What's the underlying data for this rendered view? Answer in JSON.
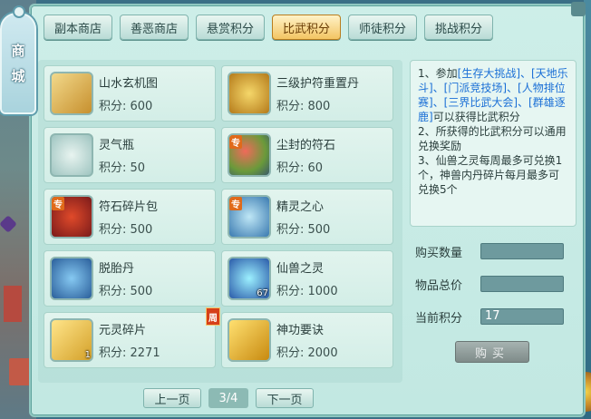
{
  "side_tab": {
    "char1": "商",
    "char2": "城"
  },
  "tabs": [
    {
      "label": "副本商店",
      "active": false
    },
    {
      "label": "善恶商店",
      "active": false
    },
    {
      "label": "悬赏积分",
      "active": false
    },
    {
      "label": "比武积分",
      "active": true
    },
    {
      "label": "师徒积分",
      "active": false
    },
    {
      "label": "挑战积分",
      "active": false
    }
  ],
  "items": [
    {
      "name": "山水玄机图",
      "points": "积分: 600",
      "icon": "scroll-icon",
      "badge": "",
      "qty": "",
      "weekly": ""
    },
    {
      "name": "三级护符重置丹",
      "points": "积分: 800",
      "icon": "amulet-icon",
      "badge": "",
      "qty": "",
      "weekly": ""
    },
    {
      "name": "灵气瓶",
      "points": "积分: 50",
      "icon": "bottle-icon",
      "badge": "",
      "qty": "",
      "weekly": ""
    },
    {
      "name": "尘封的符石",
      "points": "积分: 60",
      "icon": "stone-icon",
      "badge": "专",
      "qty": "",
      "weekly": ""
    },
    {
      "name": "符石碎片包",
      "points": "积分: 500",
      "icon": "bag-icon",
      "badge": "专",
      "qty": "",
      "weekly": ""
    },
    {
      "name": "精灵之心",
      "points": "积分: 500",
      "icon": "heart-icon",
      "badge": "专",
      "qty": "",
      "weekly": ""
    },
    {
      "name": "脱胎丹",
      "points": "积分: 500",
      "icon": "pill-icon",
      "badge": "",
      "qty": "",
      "weekly": ""
    },
    {
      "name": "仙兽之灵",
      "points": "积分: 1000",
      "icon": "orb-icon",
      "badge": "",
      "qty": "67",
      "weekly": ""
    },
    {
      "name": "元灵碎片",
      "points": "积分: 2271",
      "icon": "shard-icon",
      "badge": "",
      "qty": "1",
      "weekly": "周"
    },
    {
      "name": "神功要诀",
      "points": "积分: 2000",
      "icon": "book-icon",
      "badge": "",
      "qty": "",
      "weekly": ""
    }
  ],
  "pager": {
    "prev": "上一页",
    "page": "3/4",
    "next": "下一页"
  },
  "info": {
    "line1_a": "1、参加",
    "line1_b": "[生存大挑战]、[天地乐斗]、[门派竞技场]、[人物排位赛]、[三界比武大会]、[群雄逐鹿]",
    "line1_c": "可以获得比武积分",
    "line2": "2、所获得的比武积分可以通用兑换奖励",
    "line3": "3、仙兽之灵每周最多可兑换1个，神兽内丹碎片每月最多可兑换5个"
  },
  "form": {
    "qty_label": "购买数量",
    "qty_value": "",
    "total_label": "物品总价",
    "total_value": "",
    "current_label": "当前积分",
    "current_value": "17",
    "buy": "购买"
  }
}
